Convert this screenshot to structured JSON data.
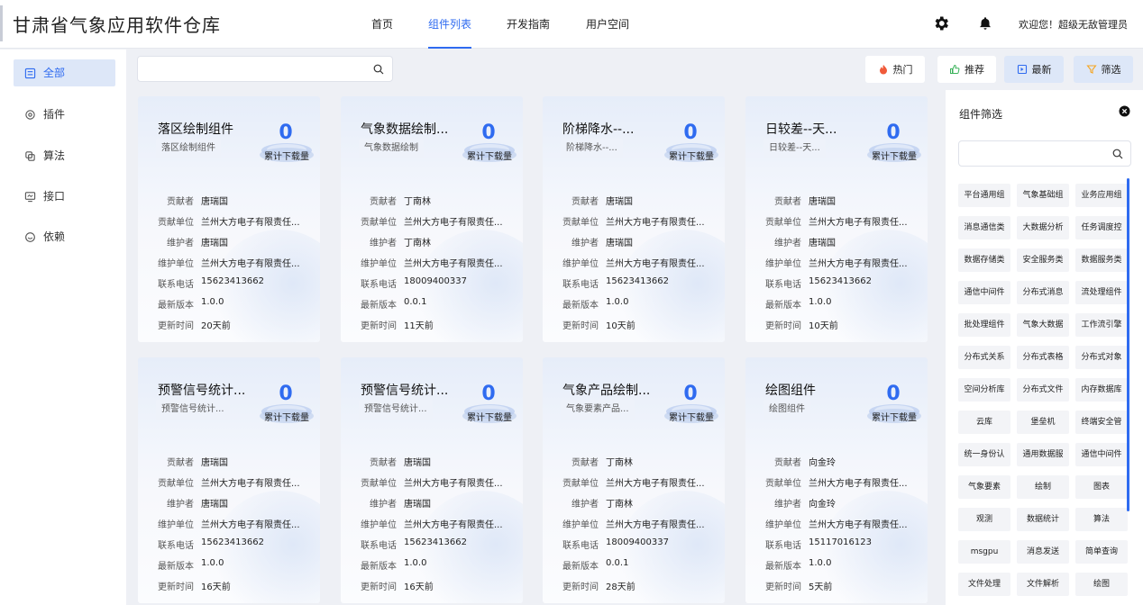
{
  "site_title": "甘肃省气象应用软件仓库",
  "nav": [
    "首页",
    "组件列表",
    "开发指南",
    "用户空间"
  ],
  "welcome": "欢迎您！超级无敌管理员",
  "sidebar": [
    "全部",
    "插件",
    "算法",
    "接口",
    "依赖"
  ],
  "search": {
    "value": "",
    "placeholder": ""
  },
  "filters": [
    "热门",
    "推荐",
    "最新",
    "筛选"
  ],
  "labels": {
    "downloads": "累计下载量",
    "contributor": "贡献者",
    "contrib_unit": "贡献单位",
    "maintainer": "维护者",
    "maint_unit": "维护单位",
    "phone": "联系电话",
    "version": "最新版本",
    "updated": "更新时间"
  },
  "cards": [
    {
      "title": "落区绘制组件",
      "subtitle": "落区绘制组件",
      "downloads": "0",
      "contributor": "唐瑞国",
      "contrib_unit": "兰州大方电子有限责任...",
      "maintainer": "唐瑞国",
      "maint_unit": "兰州大方电子有限责任...",
      "phone": "15623413662",
      "version": "1.0.0",
      "updated": "20天前"
    },
    {
      "title": "气象数据绘制...",
      "subtitle": "气象数据绘制",
      "downloads": "0",
      "contributor": "丁南林",
      "contrib_unit": "兰州大方电子有限责任...",
      "maintainer": "丁南林",
      "maint_unit": "兰州大方电子有限责任...",
      "phone": "18009400337",
      "version": "0.0.1",
      "updated": "11天前"
    },
    {
      "title": "阶梯降水--...",
      "subtitle": "阶梯降水--...",
      "downloads": "0",
      "contributor": "唐瑞国",
      "contrib_unit": "兰州大方电子有限责任...",
      "maintainer": "唐瑞国",
      "maint_unit": "兰州大方电子有限责任...",
      "phone": "15623413662",
      "version": "1.0.0",
      "updated": "10天前"
    },
    {
      "title": "日较差--天...",
      "subtitle": "日较差--天...",
      "downloads": "0",
      "contributor": "唐瑞国",
      "contrib_unit": "兰州大方电子有限责任...",
      "maintainer": "唐瑞国",
      "maint_unit": "兰州大方电子有限责任...",
      "phone": "15623413662",
      "version": "1.0.0",
      "updated": "10天前"
    },
    {
      "title": "预警信号统计...",
      "subtitle": "预警信号统计...",
      "downloads": "0",
      "contributor": "唐瑞国",
      "contrib_unit": "兰州大方电子有限责任...",
      "maintainer": "唐瑞国",
      "maint_unit": "兰州大方电子有限责任...",
      "phone": "15623413662",
      "version": "1.0.0",
      "updated": "16天前"
    },
    {
      "title": "预警信号统计...",
      "subtitle": "预警信号统计...",
      "downloads": "0",
      "contributor": "唐瑞国",
      "contrib_unit": "兰州大方电子有限责任...",
      "maintainer": "唐瑞国",
      "maint_unit": "兰州大方电子有限责任...",
      "phone": "15623413662",
      "version": "1.0.0",
      "updated": "16天前"
    },
    {
      "title": "气象产品绘制...",
      "subtitle": "气象要素产品...",
      "downloads": "0",
      "contributor": "丁南林",
      "contrib_unit": "兰州大方电子有限责任...",
      "maintainer": "丁南林",
      "maint_unit": "兰州大方电子有限责任...",
      "phone": "18009400337",
      "version": "0.0.1",
      "updated": "28天前"
    },
    {
      "title": "绘图组件",
      "subtitle": "绘图组件",
      "downloads": "0",
      "contributor": "向金玲",
      "contrib_unit": "兰州大方电子有限责任...",
      "maintainer": "向金玲",
      "maint_unit": "兰州大方电子有限责任...",
      "phone": "15117016123",
      "version": "1.0.0",
      "updated": "5天前"
    }
  ],
  "panel": {
    "title": "组件筛选",
    "search": {
      "value": "",
      "placeholder": ""
    },
    "tags": [
      "平台通用组",
      "气象基础组",
      "业务应用组",
      "消息通信类",
      "大数据分析",
      "任务调度控",
      "数据存储类",
      "安全服务类",
      "数据服务类",
      "通信中间件",
      "分布式消息",
      "流处理组件",
      "批处理组件",
      "气象大数据",
      "工作流引擎",
      "分布式关系",
      "分布式表格",
      "分布式对象",
      "空间分析库",
      "分布式文件",
      "内存数据库",
      "云库",
      "堡垒机",
      "终端安全管",
      "统一身份认",
      "通用数据服",
      "通信中间件",
      "气象要素",
      "绘制",
      "图表",
      "观测",
      "数据统计",
      "算法",
      "msgpu",
      "消息发送",
      "简单查询",
      "文件处理",
      "文件解析",
      "绘图"
    ]
  },
  "colors": {
    "accent": "#2f6bf0",
    "hot": "#f05a3a",
    "recommend": "#3bb35b",
    "newest": "#2f6bf0",
    "filter": "#f5a623"
  }
}
